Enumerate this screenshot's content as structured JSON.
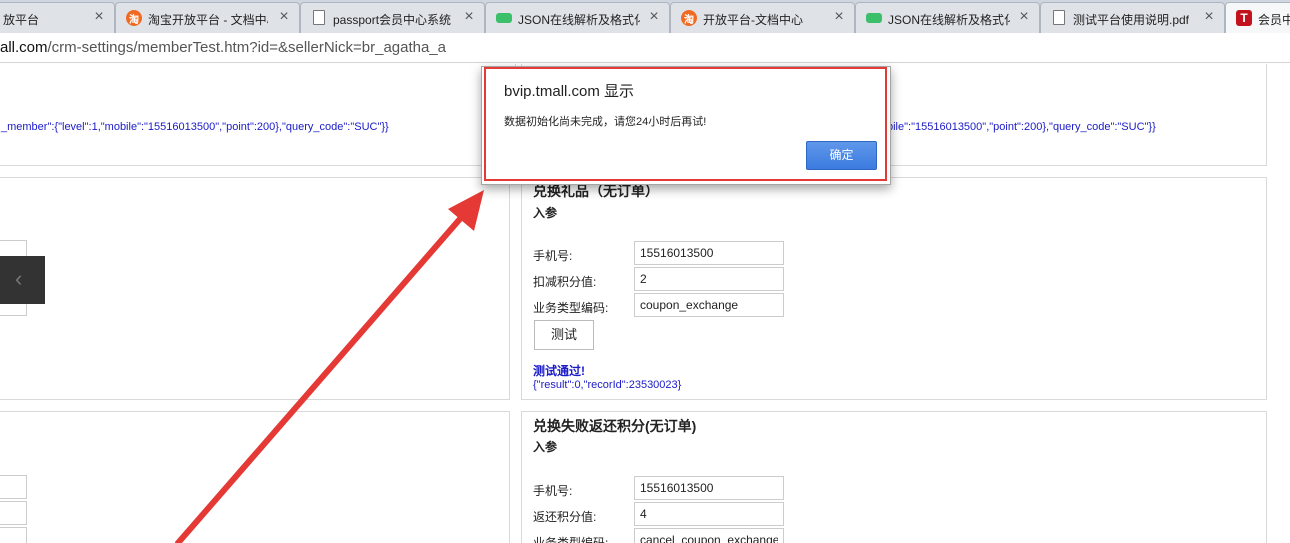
{
  "tabs": [
    {
      "title": "放平台",
      "icon": "taobao-icon"
    },
    {
      "title": "淘宝开放平台 - 文档中心",
      "icon": "taobao-icon"
    },
    {
      "title": "passport会员中心系统",
      "icon": "document-icon"
    },
    {
      "title": "JSON在线解析及格式化",
      "icon": "json-icon"
    },
    {
      "title": "开放平台-文档中心",
      "icon": "taobao-icon"
    },
    {
      "title": "JSON在线解析及格式化",
      "icon": "json-icon"
    },
    {
      "title": "测试平台使用说明.pdf",
      "icon": "document-icon"
    },
    {
      "title": "会员中",
      "icon": "tmall-t-icon"
    }
  ],
  "address_bar": {
    "host": "all.com",
    "path": "/crm-settings/memberTest.htm?id=&sellerNick=br_agatha_a"
  },
  "top_panel": {
    "left_json": "_member\":{\"level\":1,\"mobile\":\"15516013500\",\"point\":200},\"query_code\":\"SUC\"}}",
    "right_json": "bile\":\"15516013500\",\"point\":200},\"query_code\":\"SUC\"}}"
  },
  "exchange_gift": {
    "title": "兑换礼品（无订单）",
    "subtitle": "入参",
    "fields": [
      {
        "label": "手机号:",
        "value": "15516013500"
      },
      {
        "label": "扣减积分值:",
        "value": "2"
      },
      {
        "label": "业务类型编码:",
        "value": "coupon_exchange"
      }
    ],
    "button": "测试",
    "result_status": "测试通过!",
    "result_json": "{\"result\":0,\"recorId\":23530023}"
  },
  "refund_points": {
    "title": "兑换失败返还积分(无订单)",
    "subtitle": "入参",
    "fields": [
      {
        "label": "手机号:",
        "value": "15516013500"
      },
      {
        "label": "返还积分值:",
        "value": "4"
      },
      {
        "label": "业务类型编码:",
        "value": "cancel_coupon_exchange"
      }
    ]
  },
  "carousel": {
    "prev_glyph": "‹"
  },
  "alert": {
    "title": "bvip.tmall.com 显示",
    "message": "数据初始化尚未完成，请您24小时后再试!",
    "ok_label": "确定"
  },
  "colors": {
    "link_blue": "#1a1ac8",
    "annotation_red": "#e53935",
    "dialog_button": "#3b7be0"
  }
}
